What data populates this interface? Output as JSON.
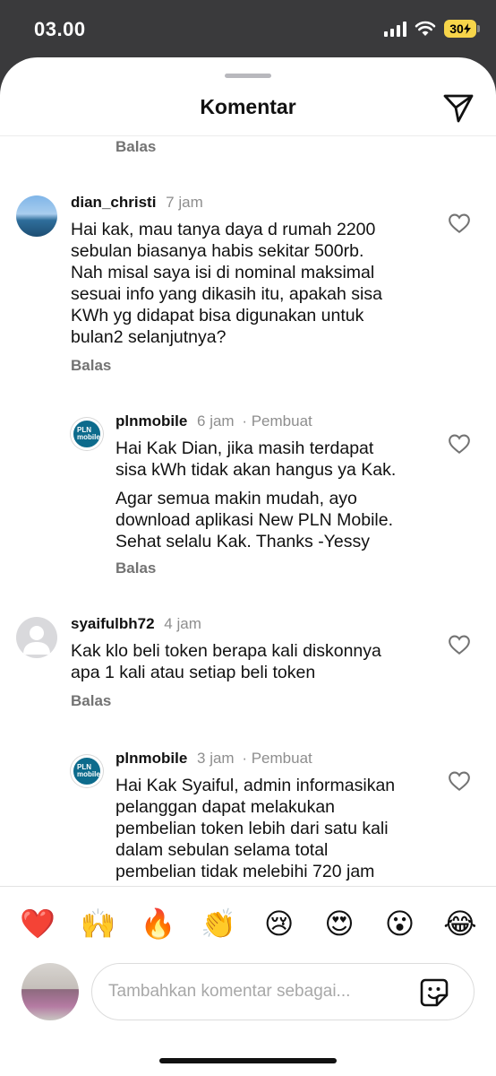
{
  "status_bar": {
    "time": "03.00",
    "battery": "30"
  },
  "sheet": {
    "title": "Komentar"
  },
  "top_reply_label": "Balas",
  "comments": [
    {
      "username": "dian_christi",
      "time": "7 jam",
      "lines": [
        "Hai kak, mau tanya daya d rumah 2200",
        "sebulan biasanya habis sekitar 500rb.",
        "Nah misal saya isi di nominal maksimal",
        "sesuai info yang dikasih itu, apakah sisa",
        "KWh yg didapat bisa digunakan untuk",
        "bulan2 selanjutnya?"
      ],
      "reply_label": "Balas"
    },
    {
      "username": "plnmobile",
      "time": "6 jam",
      "tag": "· Pembuat",
      "avatar_text": "PLN mobile",
      "lines": [
        "Hai Kak Dian, jika masih terdapat",
        "sisa kWh tidak akan hangus ya Kak.",
        "Agar semua makin mudah, ayo",
        "download aplikasi New PLN Mobile.",
        "Sehat selalu Kak. Thanks -Yessy"
      ],
      "reply_label": "Balas"
    },
    {
      "username": "syaifulbh72",
      "time": "4 jam",
      "lines": [
        "Kak klo beli token berapa kali diskonnya",
        "apa 1 kali atau setiap beli token"
      ],
      "reply_label": "Balas"
    },
    {
      "username": "plnmobile",
      "time": "3 jam",
      "tag": "· Pembuat",
      "avatar_text": "PLN mobile",
      "lines": [
        "Hai Kak Syaiful, admin informasikan",
        "pelanggan dapat melakukan",
        "pembelian token lebih dari satu kali",
        "dalam sebulan selama total",
        "pembelian tidak melebihi 720 jam"
      ]
    }
  ],
  "reactions": [
    "❤️",
    "🙌",
    "🔥",
    "👏",
    "😢",
    "😍",
    "😮",
    "😂"
  ],
  "composer": {
    "placeholder": "Tambahkan komentar sebagai..."
  }
}
